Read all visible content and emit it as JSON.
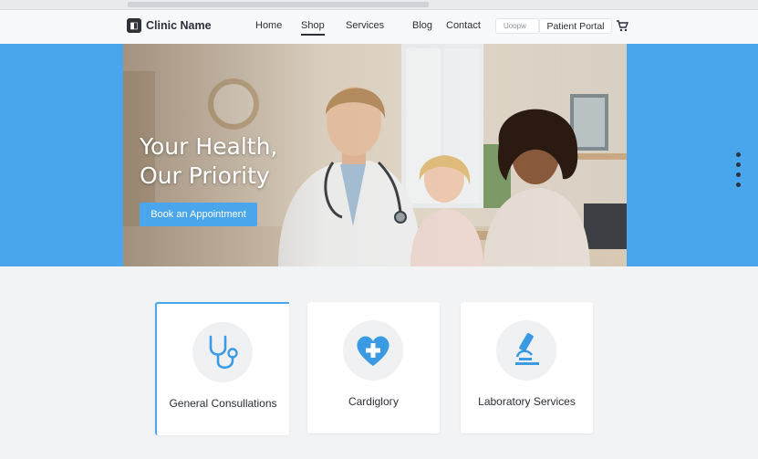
{
  "brand": {
    "name": "Clinic Name"
  },
  "nav": [
    {
      "label": "Home",
      "active": false
    },
    {
      "label": "Shop",
      "active": true
    },
    {
      "label": "Services",
      "active": false
    },
    {
      "label": "Blog",
      "active": false
    },
    {
      "label": "Contact",
      "active": false
    }
  ],
  "search": {
    "placeholder": "Uoopw"
  },
  "header": {
    "portal_label": "Patient Portal",
    "cart_icon": "cart-icon"
  },
  "hero": {
    "title_line1": "Your Health,",
    "title_line2": "Our Priority",
    "cta_label": "Book an Appointment"
  },
  "colors": {
    "accent": "#4aa6ec",
    "text": "#2b2f36",
    "page_bg": "#f1f3f5"
  },
  "services": [
    {
      "label": "General Consullations",
      "icon": "stethoscope-icon"
    },
    {
      "label": "Cardigloгy",
      "icon": "heart-cross-icon"
    },
    {
      "label": "Laboratory Services",
      "icon": "microscope-icon"
    }
  ]
}
